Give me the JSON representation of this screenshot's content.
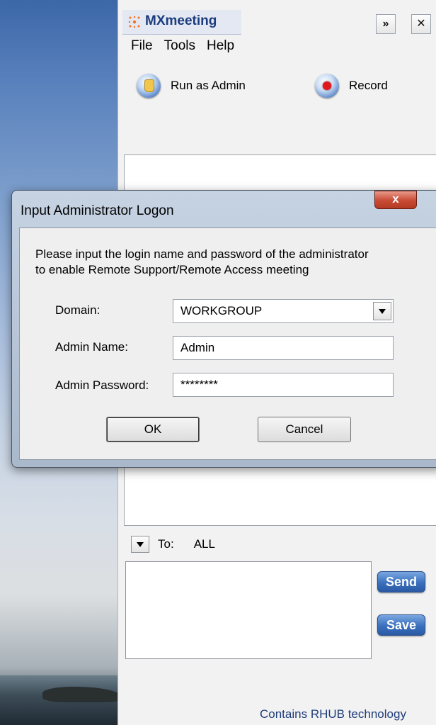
{
  "app": {
    "title": "MXmeeting",
    "chevron_label": "»",
    "close_label": "✕",
    "accent_color": "#1b3c7e"
  },
  "menu": [
    "File",
    "Tools",
    "Help"
  ],
  "toolbar": {
    "run_as_admin": "Run as Admin",
    "record": "Record"
  },
  "chat": {
    "to_label": "To:",
    "to_value": "ALL",
    "send_label": "Send",
    "save_label": "Save"
  },
  "footer": {
    "text": "Contains RHUB technology"
  },
  "dialog": {
    "title": "Input Administrator Logon",
    "close_label": "x",
    "message_line1": "Please input the login name and password of the administrator",
    "message_line2": "to enable Remote Support/Remote Access meeting",
    "domain_label": "Domain:",
    "domain_value": "WORKGROUP",
    "admin_name_label": "Admin Name:",
    "admin_name_value": "Admin",
    "admin_password_label": "Admin Password:",
    "admin_password_value": "********",
    "ok_label": "OK",
    "cancel_label": "Cancel"
  }
}
